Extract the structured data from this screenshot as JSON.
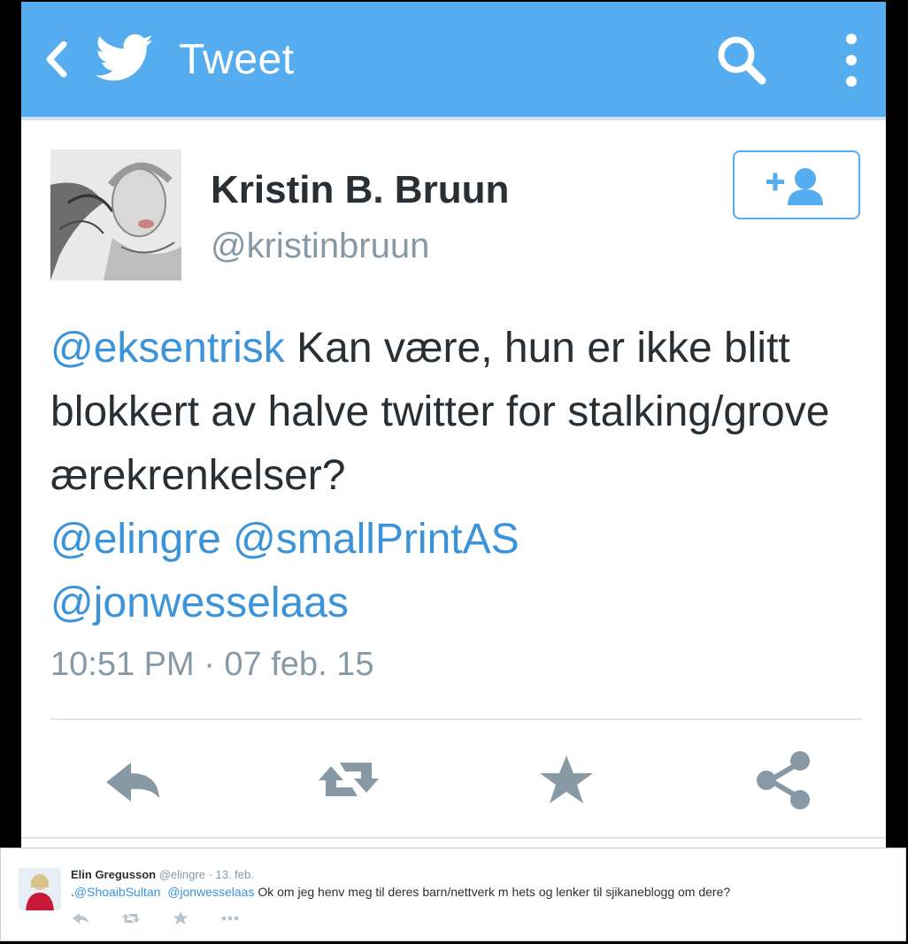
{
  "header": {
    "title": "Tweet",
    "back_icon": "chevron-left-icon",
    "logo_icon": "twitter-bird-icon",
    "search_icon": "search-icon",
    "more_icon": "more-vertical-icon",
    "color": "#55acee"
  },
  "tweet": {
    "author_name": "Kristin B. Bruun",
    "author_handle": "@kristinbruun",
    "follow_icon": "add-user-icon",
    "text": {
      "mention1": "@eksentrisk",
      "body": " Kan være, hun er ikke blitt blokkert av halve twitter for stalking/grove ærekrenkelser? ",
      "mention2": "@elingre",
      "mention3": "@smallPrintAS",
      "mention4": "@jonwesselaas"
    },
    "timestamp": "10:51 PM · 07 feb. 15",
    "actions": [
      "reply-icon",
      "retweet-icon",
      "favorite-star-icon",
      "share-icon"
    ]
  },
  "reply": {
    "author_name": "Elin Gregusson",
    "author_handle": "@elingre",
    "date": "· 13. feb.",
    "prefix": ".",
    "mention1": "@ShoaibSultan",
    "mention2": "@jonwesselaas",
    "text": " Ok om jeg henv meg til deres barn/nettverk m hets og lenker til sjikaneblogg om dere?",
    "actions": [
      "reply-icon",
      "retweet-icon",
      "favorite-star-icon",
      "more-icon"
    ]
  },
  "colors": {
    "link": "#3b94d9",
    "text": "#292f33",
    "muted": "#8899a6"
  }
}
